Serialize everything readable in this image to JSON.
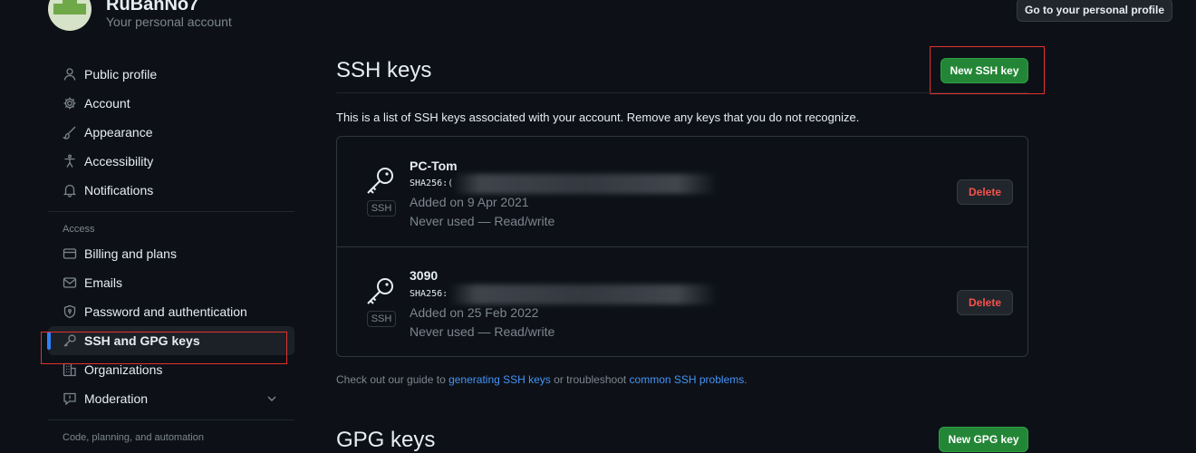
{
  "header": {
    "username": "RuBanNo7",
    "subtitle": "Your personal account",
    "profile_button": "Go to your personal profile"
  },
  "sidebar": {
    "items": [
      {
        "label": "Public profile",
        "icon": "person-icon"
      },
      {
        "label": "Account",
        "icon": "gear-icon"
      },
      {
        "label": "Appearance",
        "icon": "paintbrush-icon"
      },
      {
        "label": "Accessibility",
        "icon": "accessibility-icon"
      },
      {
        "label": "Notifications",
        "icon": "bell-icon"
      }
    ],
    "access_heading": "Access",
    "access_items": [
      {
        "label": "Billing and plans",
        "icon": "credit-card-icon"
      },
      {
        "label": "Emails",
        "icon": "mail-icon"
      },
      {
        "label": "Password and authentication",
        "icon": "shield-lock-icon"
      },
      {
        "label": "SSH and GPG keys",
        "icon": "key-icon",
        "active": true
      },
      {
        "label": "Organizations",
        "icon": "organization-icon"
      },
      {
        "label": "Moderation",
        "icon": "report-icon",
        "expandable": true
      }
    ],
    "code_heading": "Code, planning, and automation"
  },
  "ssh": {
    "title": "SSH keys",
    "new_button": "New SSH key",
    "description": "This is a list of SSH keys associated with your account. Remove any keys that you do not recognize.",
    "keys": [
      {
        "title": "PC-Tom",
        "fingerprint": "SHA256:(",
        "added": "Added on 9 Apr 2021",
        "usage": "Never used — Read/write",
        "badge": "SSH",
        "delete_label": "Delete"
      },
      {
        "title": "3090",
        "fingerprint": "SHA256:",
        "added": "Added on 25 Feb 2022",
        "usage": "Never used — Read/write",
        "badge": "SSH",
        "delete_label": "Delete"
      }
    ],
    "guide_prefix": "Check out our guide to ",
    "guide_link1": "generating SSH keys",
    "guide_middle": " or troubleshoot ",
    "guide_link2": "common SSH problems",
    "guide_suffix": "."
  },
  "gpg": {
    "title": "GPG keys",
    "new_button": "New GPG key"
  },
  "colors": {
    "background": "#0d1117",
    "accent_green": "#238636",
    "danger": "#f85149",
    "link": "#4493f8",
    "highlight_box": "#e5312e"
  }
}
